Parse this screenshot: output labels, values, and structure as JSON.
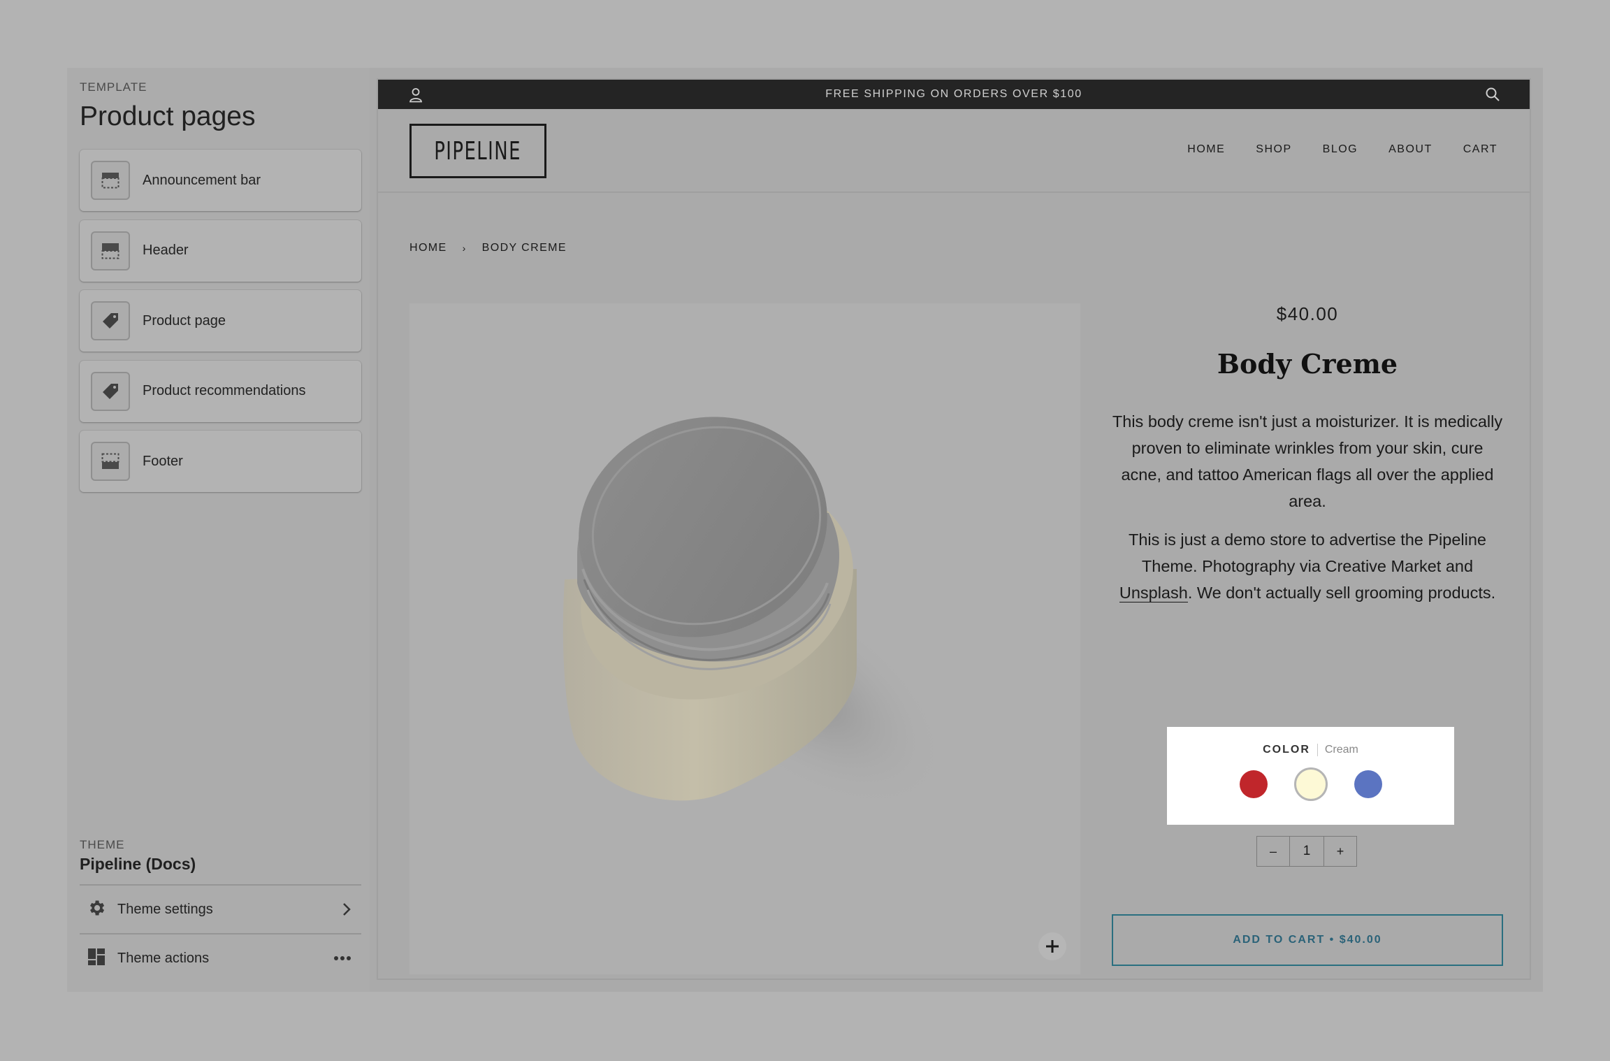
{
  "sidebar": {
    "eyebrow": "TEMPLATE",
    "title": "Product pages",
    "sections": [
      {
        "label": "Announcement bar",
        "icon": "announcement-bar-icon"
      },
      {
        "label": "Header",
        "icon": "header-section-icon"
      },
      {
        "label": "Product page",
        "icon": "tag-icon"
      },
      {
        "label": "Product recommendations",
        "icon": "tag-icon"
      },
      {
        "label": "Footer",
        "icon": "footer-section-icon"
      }
    ],
    "theme_eyebrow": "THEME",
    "theme_name": "Pipeline (Docs)",
    "theme_settings_label": "Theme settings",
    "theme_actions_label": "Theme actions"
  },
  "preview": {
    "announcement": "FREE SHIPPING ON ORDERS OVER $100",
    "logo": "PIPELINE",
    "nav": [
      "HOME",
      "SHOP",
      "BLOG",
      "ABOUT",
      "CART"
    ],
    "breadcrumb": {
      "home": "HOME",
      "sep": "›",
      "current": "BODY CREME"
    },
    "product": {
      "price": "$40.00",
      "title": "Body Creme",
      "desc1": "This body creme isn't just a moisturizer.  It is medically proven to eliminate wrinkles from your skin, cure acne, and tattoo American flags all over the applied area.",
      "desc2_a": "This is just a demo store to advertise the Pipeline Theme.  Photography via Creative Market and ",
      "desc2_link": "Unsplash",
      "desc2_b": ".  We don't actually sell grooming products.",
      "color_label": "COLOR",
      "color_value": "Cream",
      "swatches": [
        {
          "name": "Red",
          "color": "#c0262b"
        },
        {
          "name": "Cream",
          "color": "#fdf9d6"
        },
        {
          "name": "Blue",
          "color": "#5b74c1"
        }
      ],
      "qty_minus": "–",
      "qty_value": "1",
      "qty_plus": "+",
      "add_to_cart": "ADD TO CART • $40.00"
    }
  }
}
